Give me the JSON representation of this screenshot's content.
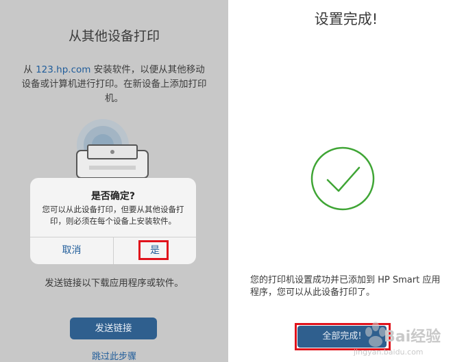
{
  "left": {
    "title": "从其他设备打印",
    "desc_prefix": "从 ",
    "desc_link": "123.hp.com",
    "desc_suffix": " 安装软件，以便从其他移动设备或计算机进行打印。在新设备上添加打印机。",
    "send_text": "发送链接以下载应用程序或软件。",
    "send_button": "发送链接",
    "skip_link": "跳过此步骤"
  },
  "dialog": {
    "title": "是否确定?",
    "message": "您可以从此设备打印，但要从其他设备打印，则必须在每个设备上安装软件。",
    "cancel": "取消",
    "confirm": "是"
  },
  "right": {
    "title": "设置完成!",
    "message": "您的打印机设置成功并已添加到 HP Smart 应用程序，您可以从此设备打印了。",
    "done_button": "全部完成!"
  },
  "watermark": {
    "text": "Bai经验",
    "sub": "jingyan.baidu.com"
  },
  "colors": {
    "accent": "#2f5f8e",
    "link": "#1f5c9a",
    "highlight": "#e0121b",
    "success": "#3fa535"
  },
  "icons": [
    "printer-icon",
    "checkmark-circle-icon",
    "baidu-paw-icon"
  ]
}
